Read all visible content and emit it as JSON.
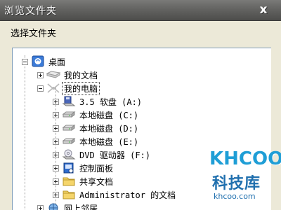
{
  "window": {
    "title": "浏览文件夹",
    "close_symbol": "x"
  },
  "dialog": {
    "prompt": "选择文件夹"
  },
  "tree": {
    "desktop": "桌面",
    "my_documents": "我的文档",
    "my_computer": "我的电脑",
    "floppy": "3.5 软盘 (A:)",
    "disk_c": "本地磁盘 (C:)",
    "disk_d": "本地磁盘 (D:)",
    "disk_e": "本地磁盘 (E:)",
    "dvd": "DVD 驱动器 (F:)",
    "control_panel": "控制面板",
    "shared_docs": "共享文档",
    "admin_docs": "Administrator 的文档",
    "network": "网上邻居"
  },
  "watermark": {
    "logo": "KHCOO",
    "brand": "科技库",
    "url": "khcoo.com"
  },
  "colors": {
    "titlebar": "#636361",
    "accent": "#1f9ed6"
  }
}
